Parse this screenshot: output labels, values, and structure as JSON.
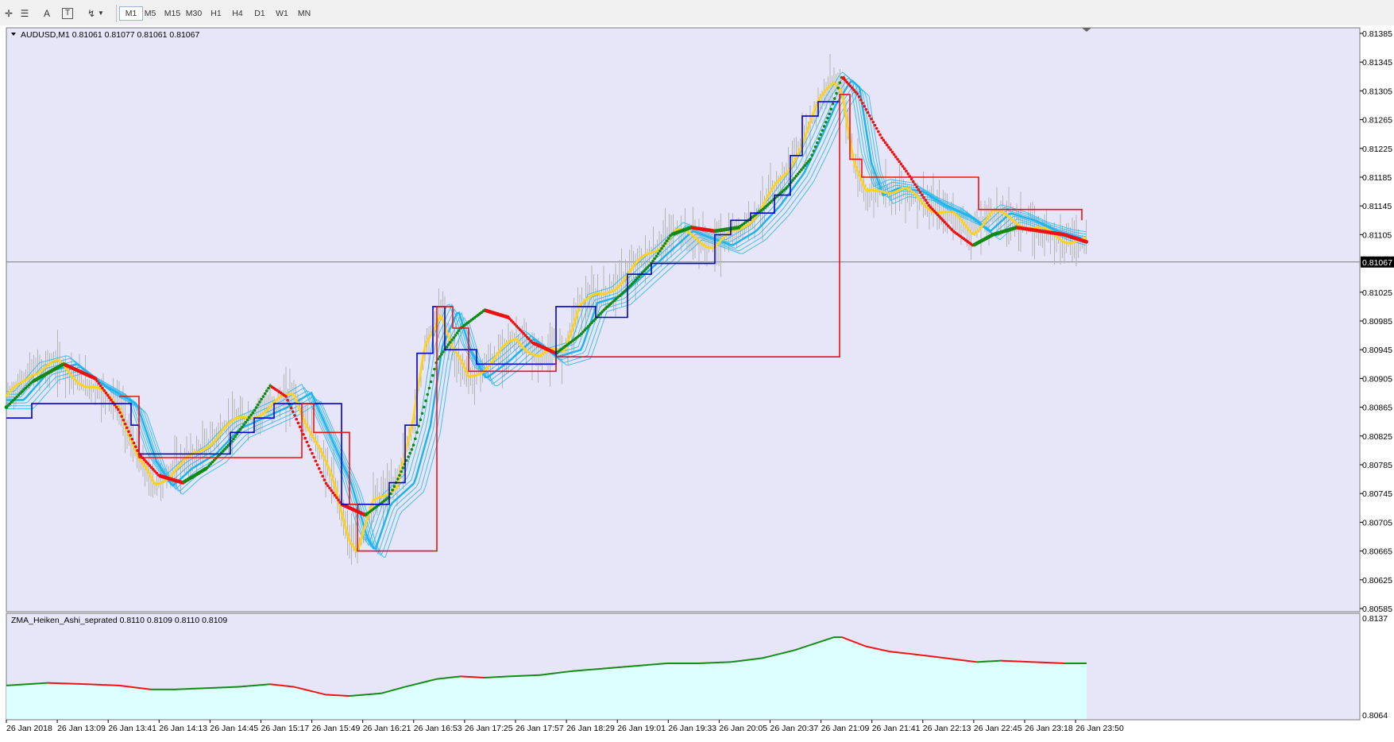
{
  "toolbar": {
    "timeframes": [
      "M1",
      "M5",
      "M15",
      "M30",
      "H1",
      "H4",
      "D1",
      "W1",
      "MN"
    ],
    "active_timeframe": "M1",
    "tools": [
      {
        "name": "crosshair-icon",
        "glyph": "✛"
      },
      {
        "name": "fibonacci-icon",
        "glyph": "☰"
      },
      {
        "name": "text-icon",
        "glyph": "A"
      },
      {
        "name": "text-label-icon",
        "glyph": "T"
      },
      {
        "name": "arrows-icon",
        "glyph": "↯"
      }
    ]
  },
  "main_chart": {
    "info": "AUDUSD,M1  0.81061 0.81077 0.81061 0.81067",
    "current_price": "0.81067",
    "price_labels": [
      "0.81385",
      "0.81345",
      "0.81305",
      "0.81265",
      "0.81225",
      "0.81185",
      "0.81145",
      "0.81105",
      "0.81067",
      "0.81025",
      "0.80985",
      "0.80945",
      "0.80905",
      "0.80865",
      "0.80825",
      "0.80785",
      "0.80745",
      "0.80705",
      "0.80665",
      "0.80625",
      "0.80585"
    ]
  },
  "sub_chart": {
    "info": "ZMA_Heiken_Ashi_seprated 0.8110 0.8109 0.8110 0.8109",
    "top_label": "0.8137",
    "bottom_label": "0.8064"
  },
  "time_labels": [
    "26 Jan 2018",
    "26 Jan 13:09",
    "26 Jan 13:41",
    "26 Jan 14:13",
    "26 Jan 14:45",
    "26 Jan 15:17",
    "26 Jan 15:49",
    "26 Jan 16:21",
    "26 Jan 16:53",
    "26 Jan 17:25",
    "26 Jan 17:57",
    "26 Jan 18:29",
    "26 Jan 19:01",
    "26 Jan 19:33",
    "26 Jan 20:05",
    "26 Jan 20:37",
    "26 Jan 21:09",
    "26 Jan 21:41",
    "26 Jan 22:13",
    "26 Jan 22:45",
    "26 Jan 23:18",
    "26 Jan 23:50"
  ],
  "colors": {
    "chart_bg": "#e6e6f8",
    "sub_bg": "#e6e6f8",
    "sub_fill": "#dcffff",
    "green": "#138a13",
    "red": "#ee1111",
    "blue": "#0000cc",
    "yellow": "#ffd21e",
    "cyan": "#1eb4ee",
    "grey_bars": "#b4b4b4"
  }
}
